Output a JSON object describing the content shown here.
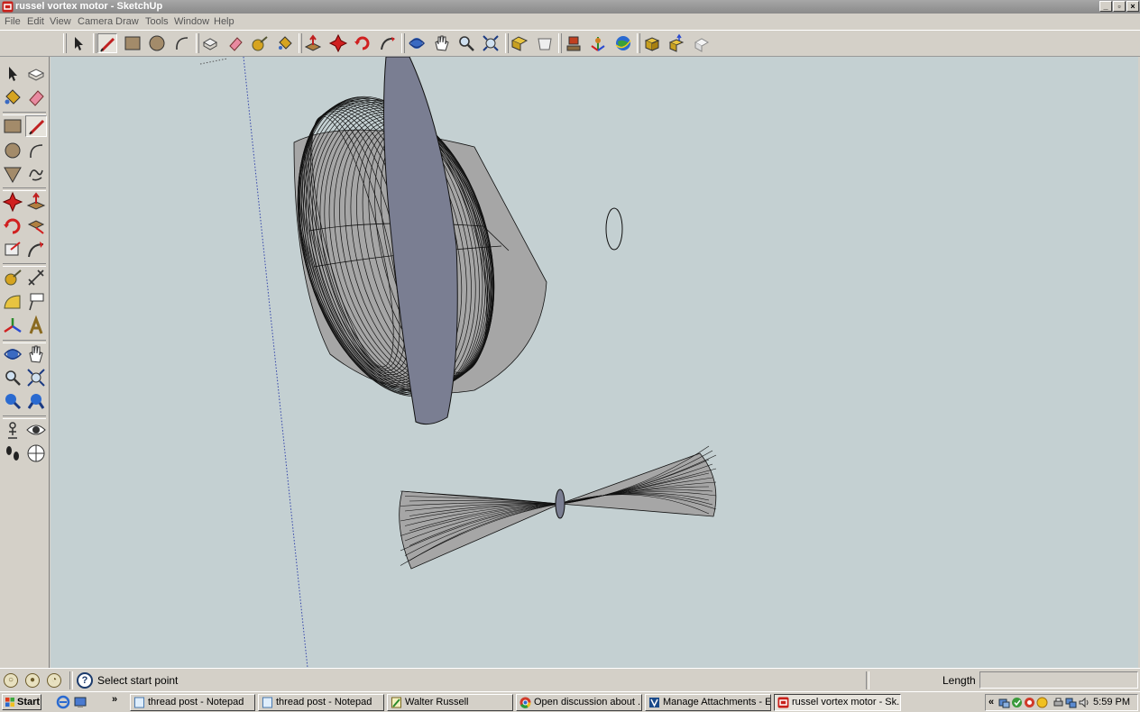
{
  "window": {
    "title": "russel vortex motor - SketchUp",
    "app_icon": "sketchup-icon",
    "controls": [
      "minimize-icon",
      "restore-icon",
      "close-icon"
    ]
  },
  "menubar": {
    "items": [
      "File",
      "Edit",
      "View",
      "Camera",
      "Draw",
      "Tools",
      "Window",
      "Help"
    ]
  },
  "toolbar": {
    "tools": [
      "select",
      "line",
      "rectangle",
      "circle",
      "arc",
      "make-component",
      "eraser",
      "tape-measure",
      "paint-bucket",
      "push-pull",
      "move",
      "rotate",
      "follow-me",
      "orbit",
      "pan",
      "zoom",
      "zoom-extents",
      "previous-view",
      "next-view",
      "standard-views",
      "iso-view",
      "section-plane",
      "get-models",
      "share-model",
      "share-component",
      "component-browser"
    ],
    "active_tool": "line"
  },
  "large_tool_set": {
    "tools": [
      "select",
      "make-component",
      "paint-bucket",
      "eraser",
      "rectangle",
      "line",
      "circle",
      "arc",
      "polygon",
      "freehand",
      "move",
      "push-pull",
      "rotate",
      "follow-me",
      "scale",
      "offset",
      "tape-measure",
      "dimension",
      "protractor",
      "text",
      "axes",
      "3d-text",
      "orbit",
      "pan",
      "zoom",
      "zoom-window",
      "previous-view",
      "zoom-extents",
      "position-camera",
      "look-around",
      "walk",
      "section-plane"
    ],
    "active_tool": "line"
  },
  "viewport": {
    "background_color": "#c4d0d2",
    "edge_color": "#111111",
    "face_color": "#a6a6a6",
    "accent_face_color": "#7a7e92",
    "axis_color": "#3344aa"
  },
  "statusbar": {
    "icons": [
      "geo-location-icon",
      "credits-icon",
      "instructor-icon",
      "help-icon"
    ],
    "message": "Select start point",
    "vcb_label": "Length",
    "vcb_value": ""
  },
  "taskbar": {
    "start_label": "Start",
    "quick_launch": [
      "ie-icon",
      "desktop-icon"
    ],
    "overflow": "»",
    "tasks": [
      {
        "label": "thread post - Notepad",
        "icon": "notepad-icon",
        "active": false
      },
      {
        "label": "thread post - Notepad",
        "icon": "notepad-icon",
        "active": false
      },
      {
        "label": "Walter Russell",
        "icon": "notepad-pen-icon",
        "active": false
      },
      {
        "label": "Open discussion about ...",
        "icon": "chrome-icon",
        "active": false
      },
      {
        "label": "Manage Attachments - E...",
        "icon": "browser-icon",
        "active": false
      },
      {
        "label": "russel vortex motor - Sk...",
        "icon": "sketchup-icon",
        "active": true
      }
    ],
    "tray_chevron": "«",
    "tray_icons": [
      "network-icon",
      "update-icon",
      "antivirus-icon",
      "shield-icon",
      "printer-icon",
      "network-status-icon",
      "volume-icon"
    ],
    "clock": "5:59 PM"
  }
}
